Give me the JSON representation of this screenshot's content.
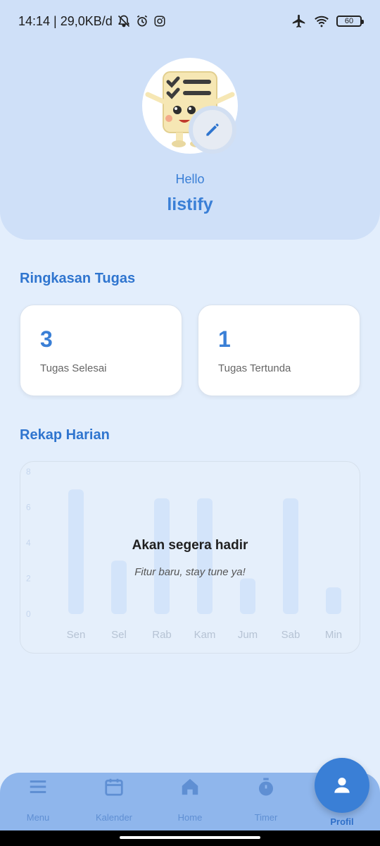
{
  "status_bar": {
    "left_text": "14:14 | 29,0KB/d",
    "battery": "60",
    "icons": [
      "bell-off-icon",
      "alarm-icon",
      "instagram-icon",
      "airplane-icon",
      "wifi-icon",
      "battery-icon"
    ]
  },
  "profile": {
    "greeting": "Hello",
    "username": "listify",
    "avatar": "checklist-mascot-image",
    "edit_icon": "pencil-icon"
  },
  "summary": {
    "title": "Ringkasan Tugas",
    "cards": [
      {
        "value": "3",
        "label": "Tugas Selesai"
      },
      {
        "value": "1",
        "label": "Tugas Tertunda"
      }
    ]
  },
  "daily": {
    "title": "Rekap Harian",
    "overlay_title": "Akan segera hadir",
    "overlay_subtitle": "Fitur baru, stay tune ya!"
  },
  "chart_data": {
    "type": "bar",
    "categories": [
      "Sen",
      "Sel",
      "Rab",
      "Kam",
      "Jum",
      "Sab",
      "Min"
    ],
    "values": [
      7,
      3,
      6.5,
      6.5,
      2,
      6.5,
      1.5
    ],
    "yticks": [
      "0",
      "2",
      "4",
      "6",
      "8"
    ],
    "ylim": [
      0,
      8
    ],
    "grid": false,
    "title": "",
    "xlabel": "",
    "ylabel": ""
  },
  "bottom_nav": {
    "items": [
      {
        "label": "Menu",
        "icon": "menu-icon"
      },
      {
        "label": "Kalender",
        "icon": "calendar-icon"
      },
      {
        "label": "Home",
        "icon": "home-icon"
      },
      {
        "label": "Timer",
        "icon": "stopwatch-icon"
      }
    ],
    "active": {
      "label": "Profil",
      "icon": "person-icon"
    }
  },
  "colors": {
    "accent": "#3a7fd6",
    "header_bg": "#cfe0f8",
    "page_bg": "#e3eefc",
    "nav_bg": "#8fb6ec"
  }
}
